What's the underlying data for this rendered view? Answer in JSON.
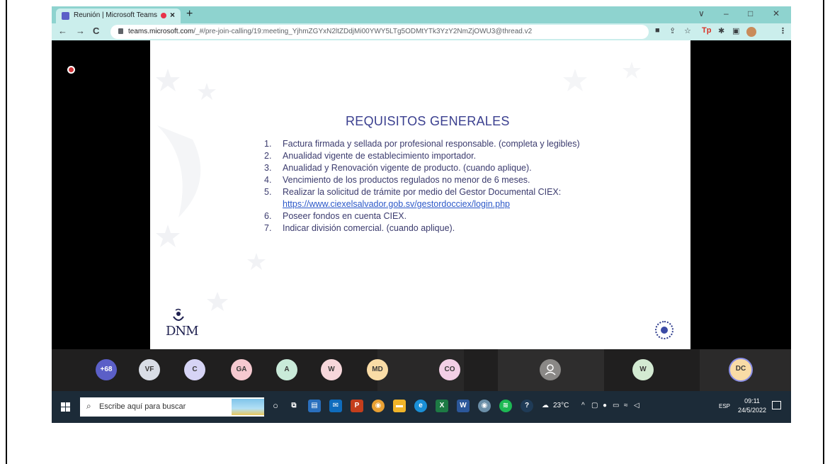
{
  "browser": {
    "tab_title": "Reunión | Microsoft Teams",
    "tab_close": "×",
    "new_tab": "+",
    "url_host": "teams.microsoft.com",
    "url_path": "/_#/pre-join-calling/19:meeting_YjhmZGYxN2ltZDdjMi00YWY5LTg5ODMtYTk3YzY2NmZjOWU3@thread.v2",
    "window_controls": {
      "chevron": "∨",
      "minimize": "–",
      "maximize": "□",
      "close": "✕"
    },
    "nav": {
      "back": "←",
      "forward": "→",
      "reload": "C"
    }
  },
  "slide": {
    "title": "REQUISITOS GENERALES",
    "items": [
      {
        "num": "1.",
        "text": "Factura firmada y sellada por profesional responsable. (completa y legibles)"
      },
      {
        "num": "2.",
        "text": "Anualidad vigente de establecimiento importador."
      },
      {
        "num": "3.",
        "text": "Anualidad y Renovación vigente de producto. (cuando aplique)."
      },
      {
        "num": "4.",
        "text": "Vencimiento de los productos regulados no menor de 6 meses."
      },
      {
        "num": "5.",
        "text": "Realizar la solicitud de trámite por medio del Gestor Documental CIEX: ",
        "link": "https://www.ciexelsalvador.gob.sv/gestordocciex/login.php"
      },
      {
        "num": "6.",
        "text": "Poseer fondos en cuenta CIEX."
      },
      {
        "num": "7.",
        "text": "Indicar división comercial. (cuando aplique)."
      }
    ],
    "logo_text": "DNM"
  },
  "participants": [
    {
      "initials": "+68",
      "bg": "#5b5fc7",
      "fg": "#ffffff"
    },
    {
      "initials": "VF",
      "bg": "#d9dde6",
      "fg": "#3b3a39"
    },
    {
      "initials": "C",
      "bg": "#d6d4f5",
      "fg": "#3b3a39"
    },
    {
      "initials": "GA",
      "bg": "#f6c9d0",
      "fg": "#3b3a39"
    },
    {
      "initials": "A",
      "bg": "#c9ead9",
      "fg": "#3b3a39"
    },
    {
      "initials": "W",
      "bg": "#f7d7db",
      "fg": "#3b3a39"
    },
    {
      "initials": "MD",
      "bg": "#f9dca6",
      "fg": "#3b3a39"
    },
    {
      "initials": "CO",
      "bg": "#f3cfe6",
      "fg": "#3b3a39"
    },
    {
      "initials": "",
      "bg": "#8a8886",
      "fg": "#ffffff"
    },
    {
      "initials": "W",
      "bg": "#d3ead2",
      "fg": "#3b3a39"
    },
    {
      "initials": "DC",
      "bg": "#f9dca6",
      "fg": "#3b3a39"
    }
  ],
  "taskbar": {
    "search_placeholder": "Escribe aquí para buscar",
    "weather": "23°C",
    "language": "ESP",
    "time": "09:11",
    "date": "24/5/2022"
  },
  "colors": {
    "tab_strip": "#8ed3cf",
    "toolbar": "#cbeeec",
    "slide_title": "#3a3f8f",
    "taskbar": "#1c2b38"
  }
}
